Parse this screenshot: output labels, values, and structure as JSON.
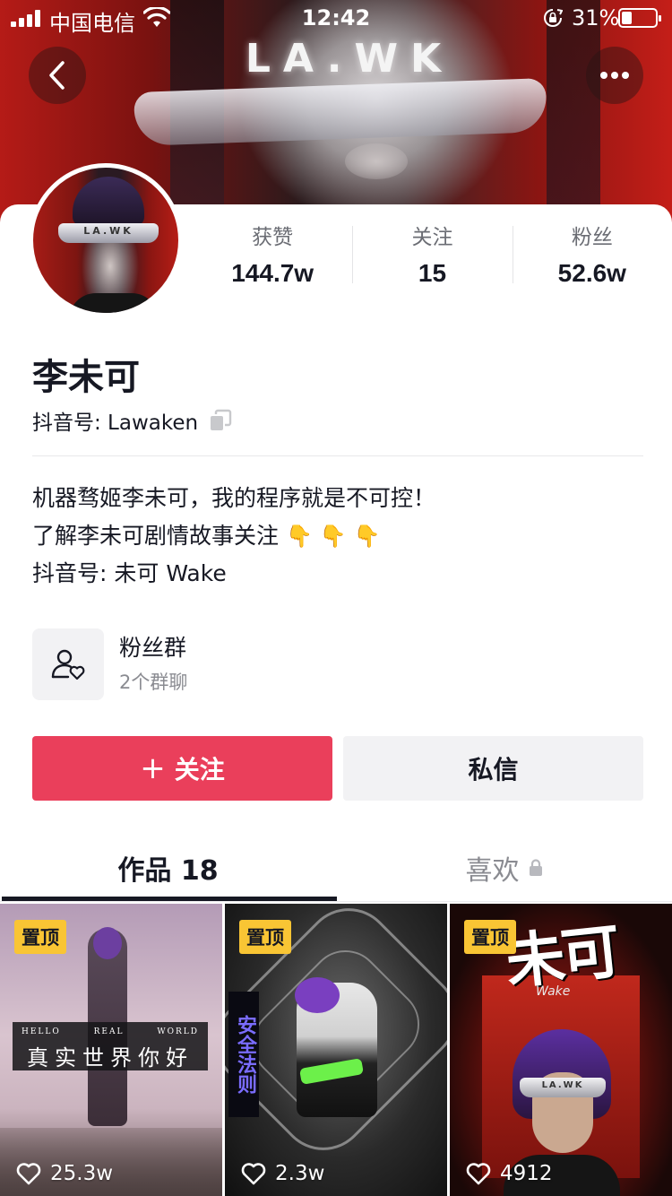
{
  "status_bar": {
    "carrier": "中国电信",
    "time": "12:42",
    "battery_percent_text": "31%",
    "battery_level": 0.31
  },
  "cover": {
    "logo_text": "LA.WK"
  },
  "profile": {
    "stats": [
      {
        "label": "获赞",
        "value": "144.7w"
      },
      {
        "label": "关注",
        "value": "15"
      },
      {
        "label": "粉丝",
        "value": "52.6w"
      }
    ],
    "nickname": "李未可",
    "douyin_id": "抖音号: Lawaken",
    "avatar_logo": "LA.WK",
    "bio": [
      "机器骛姬李未可，我的程序就是不可控！",
      "了解李未可剧情故事关注",
      "抖音号: 未可 Wake"
    ],
    "bio_emoji": "👇👇👇",
    "fan_group": {
      "title": "粉丝群",
      "subtitle": "2个群聊"
    }
  },
  "actions": {
    "follow_plus": "+",
    "follow_label": "关注",
    "message_label": "私信"
  },
  "tabs": {
    "works": "作品 18",
    "likes": "喜欢"
  },
  "videos": [
    {
      "pin_label": "置顶",
      "likes": "25.3w",
      "sign_top": [
        "HELLO",
        "REAL",
        "WORLD"
      ],
      "sign_main": "真实世界你好"
    },
    {
      "pin_label": "置顶",
      "likes": "2.3w",
      "vertical_text": "安全法则"
    },
    {
      "pin_label": "置顶",
      "likes": "4912",
      "title": "未可",
      "subtitle": "Wake",
      "visor_logo": "LA.WK"
    }
  ],
  "colors": {
    "accent_follow": "#ea3f5b",
    "pin_badge": "#f9c534",
    "text_primary": "#161823",
    "text_secondary": "#8a8b91"
  },
  "icons": {
    "back": "chevron-left-icon",
    "more": "more-dots-icon",
    "copy": "copy-icon",
    "fan_group": "user-heart-icon",
    "lock": "lock-icon",
    "like": "heart-outline-icon"
  }
}
